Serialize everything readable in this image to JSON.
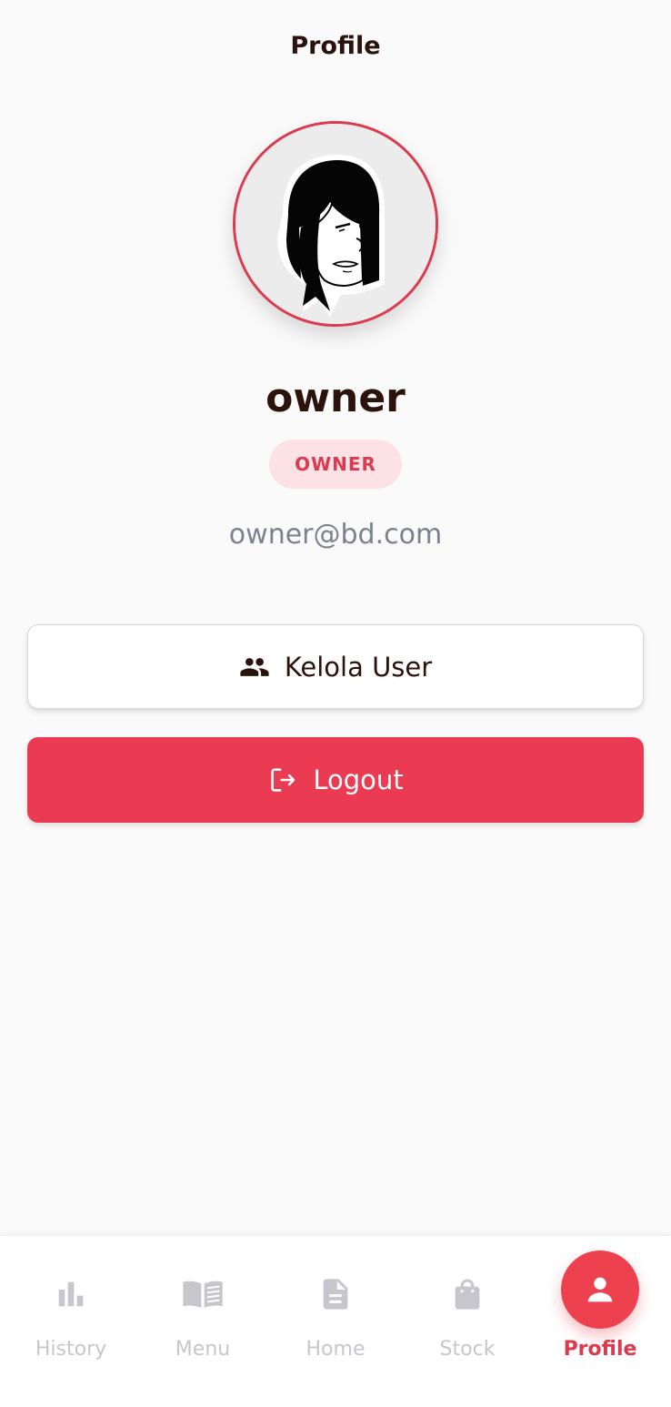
{
  "header": {
    "title": "Profile"
  },
  "profile": {
    "name": "owner",
    "role": "OWNER",
    "email": "owner@bd.com",
    "avatar_icon": "avatar-cartoon-girl"
  },
  "actions": {
    "manage_users_label": "Kelola User",
    "manage_users_icon": "people-icon",
    "logout_label": "Logout",
    "logout_icon": "logout-icon"
  },
  "bottom_nav": {
    "items": [
      {
        "label": "History",
        "icon": "bar-chart-icon",
        "active": false
      },
      {
        "label": "Menu",
        "icon": "book-icon",
        "active": false
      },
      {
        "label": "Home",
        "icon": "document-icon",
        "active": false
      },
      {
        "label": "Stock",
        "icon": "shopping-bag-icon",
        "active": false
      },
      {
        "label": "Profile",
        "icon": "person-icon",
        "active": true
      }
    ]
  },
  "colors": {
    "accent": "#eb3b53",
    "text_dark": "#2b130c",
    "text_muted": "#7d8190",
    "nav_inactive": "#c6c6cc",
    "badge_bg": "#fde2e5",
    "background": "#fafafa"
  }
}
